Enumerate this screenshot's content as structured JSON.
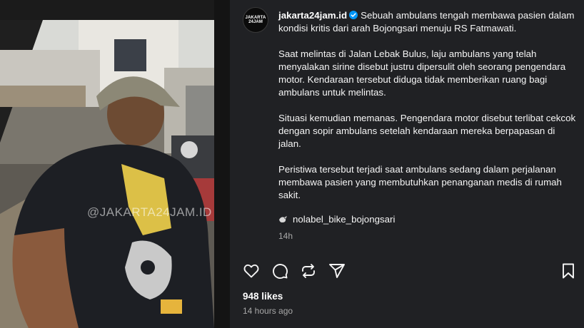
{
  "media": {
    "watermark": "@JAKARTA24JAM.ID"
  },
  "post": {
    "avatar_text": "JAKARTA 24JAM",
    "username": "jakarta24jam.id",
    "caption": [
      "Sebuah ambulans tengah membawa pasien dalam kondisi kritis dari arah Bojongsari menuju RS Fatmawati.",
      "Saat melintas di Jalan Lebak Bulus, laju ambulans yang telah menyalakan sirine disebut justru dipersulit oleh seorang pengendara motor. Kendaraan tersebut diduga tidak memberikan ruang bagi ambulans untuk melintas.",
      "Situasi kemudian memanas. Pengendara motor disebut terlibat cekcok dengan sopir ambulans setelah kendaraan mereka berpapasan di jalan.",
      "Peristiwa tersebut terjadi saat ambulans sedang dalam perjalanan membawa pasien yang membutuhkan penanganan medis di rumah sakit."
    ],
    "tag": "nolabel_bike_bojongsari",
    "time_short": "14h",
    "likes": "948 likes",
    "time_long": "14 hours ago"
  },
  "icons": {
    "verified": "verified-badge-icon",
    "tag": "bird-tag-icon",
    "like": "heart-icon",
    "comment": "comment-icon",
    "share": "repost-icon",
    "send": "send-icon",
    "save": "bookmark-icon"
  },
  "colors": {
    "panel_bg": "#202124",
    "verified": "#0095f6",
    "muted_text": "#a8a8a8"
  }
}
